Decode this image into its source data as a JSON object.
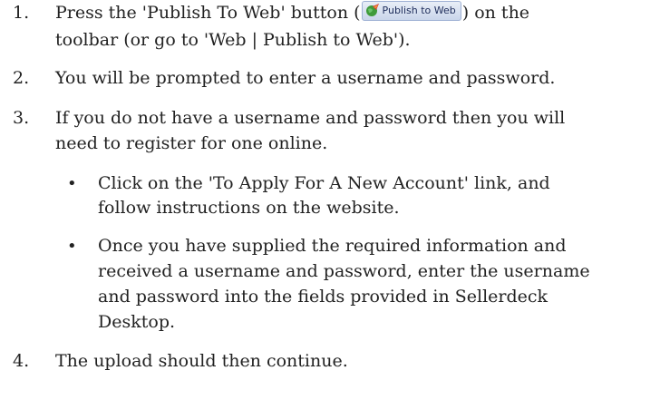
{
  "steps": [
    {
      "number": "1.",
      "line1_before": "Press the 'Publish To Web' button (",
      "line1_after": ") on the",
      "line2": "toolbar (or go to 'Web | Publish to Web')."
    },
    {
      "number": "2.",
      "line1": "You will be prompted to enter a username and password."
    },
    {
      "number": "3.",
      "line1": "If you do not have a username and password then you will",
      "line2": "need to register for one online."
    },
    {
      "number": "4.",
      "line1": "The upload should then continue."
    }
  ],
  "publish_button": {
    "label": "Publish to Web",
    "icon": "globe-rocket-icon"
  },
  "bullets": [
    {
      "symbol": "•",
      "lines": [
        "Click on the 'To Apply For A New Account' link, and",
        "follow instructions on the website."
      ]
    },
    {
      "symbol": "•",
      "lines": [
        "Once you have supplied the required information and",
        "received a username and password, enter the username",
        "and password into the fields provided in Sellerdeck",
        "Desktop."
      ]
    }
  ],
  "colors": {
    "text": "#222222",
    "button_bg": "#c9d5ea",
    "button_text": "#1d2c5a"
  }
}
